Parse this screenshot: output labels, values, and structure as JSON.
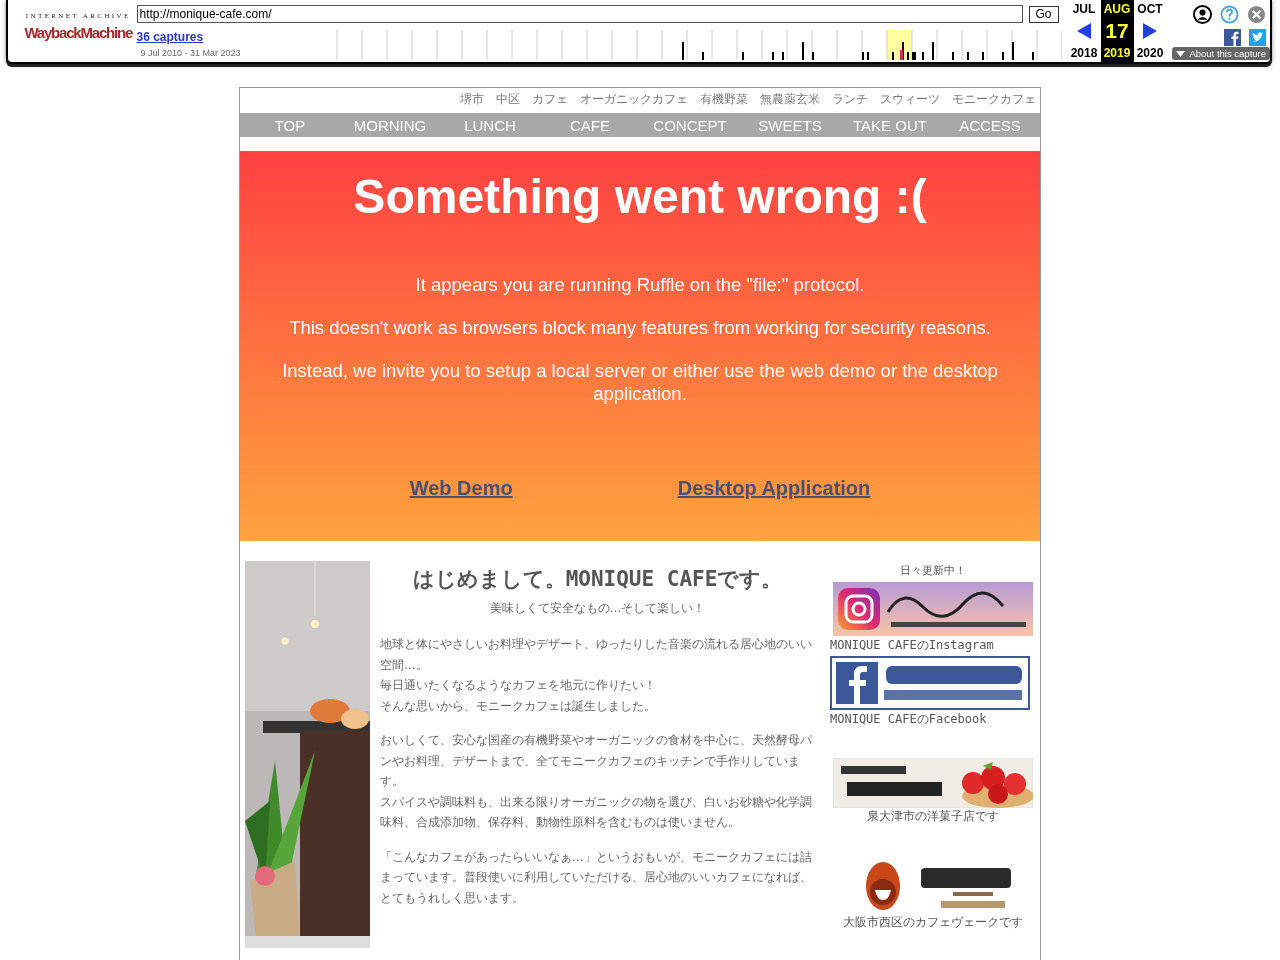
{
  "wayback": {
    "logo_top": "INTERNET ARCHIVE",
    "logo_main": "WaybackMachine",
    "url": "http://monique-cafe.com/",
    "go": "Go",
    "captures": "36 captures",
    "range": "9 Jul 2010 - 31 Mar 2023",
    "months": [
      {
        "month": "JUL",
        "year": "2018",
        "selected": false
      },
      {
        "month": "AUG",
        "day": "17",
        "year": "2019",
        "selected": true
      },
      {
        "month": "OCT",
        "year": "2020",
        "selected": false
      }
    ],
    "about": "About this capture"
  },
  "keywords": "堺市　中区　カフェ　オーガニックカフェ　有機野菜　無農薬玄米　ランチ　スウィーツ　モニークカフェ",
  "nav": [
    "TOP",
    "MORNING",
    "LUNCH",
    "CAFE",
    "CONCEPT",
    "SWEETS",
    "TAKE OUT",
    "ACCESS"
  ],
  "error": {
    "title": "Something went wrong :(",
    "paragraphs": [
      "It appears you are running Ruffle on the \"file:\" protocol.",
      "This doesn't work as browsers block many features from working for security reasons.",
      "Instead, we invite you to setup a local server or either use the web demo or the desktop application."
    ],
    "links": [
      "Web Demo",
      "Desktop Application"
    ]
  },
  "intro": {
    "heading": "はじめまして。MONIQUE CAFEです。",
    "subheading": "美味しくて安全なもの…そして楽しい！",
    "paragraphs": [
      [
        "地球と体にやさしいお料理やデザート、ゆったりした音楽の流れる居心地のいい空間…。",
        "毎日通いたくなるようなカフェを地元に作りたい！",
        "そんな思いから、モニークカフェは誕生しました。"
      ],
      [
        "おいしくて、安心な国産の有機野菜やオーガニックの食材を中心に、天然酵母パンやお料理、デザートまで、全てモニークカフェのキッチンで手作りしています。",
        "スパイスや調味料も、出来る限りオーガニックの物を選び、白いお砂糖や化学調味料、合成添加物、保存料、動物性原料を含むものは使いません。"
      ],
      [
        "「こんなカフェがあったらいいなぁ…」というおもいが、モニークカフェには詰まっています。普段使いに利用していただける、居心地のいいカフェになれば、とてもうれしく思います。"
      ]
    ]
  },
  "sidebar": {
    "note": "日々更新中！",
    "banners": [
      {
        "kind": "instagram",
        "caption": "MONIQUE CAFEのInstagram"
      },
      {
        "kind": "facebook",
        "caption": "MONIQUE CAFEのFacebook"
      },
      {
        "kind": "sweets",
        "caption": "泉大津市の洋菓子店です"
      },
      {
        "kind": "coffee",
        "caption": "大阪市西区のカフェヴェークです"
      }
    ]
  }
}
